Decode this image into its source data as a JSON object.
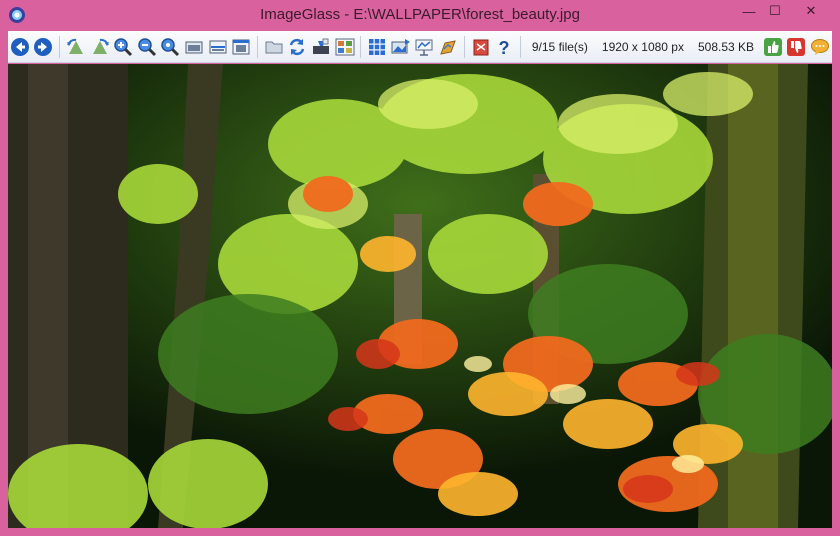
{
  "window": {
    "title": "ImageGlass - E:\\WALLPAPER\\forest_beauty.jpg"
  },
  "window_controls": {
    "minimize": "—",
    "maximize": "☐",
    "close": "✕"
  },
  "status": {
    "file_position": "9/15 file(s)",
    "dimensions": "1920 x 1080 px",
    "file_size": "508.53 KB"
  },
  "toolbar_icons": [
    "back-arrow-icon",
    "forward-arrow-icon",
    "rotate-left-icon",
    "rotate-right-icon",
    "zoom-in-icon",
    "zoom-out-icon",
    "actual-size-icon",
    "window-fit-icon",
    "fit-width-icon",
    "fit-height-icon",
    "open-folder-icon",
    "refresh-icon",
    "goto-image-icon",
    "thumbnail-icon",
    "grid-icon",
    "slideshow-icon",
    "fullscreen-icon",
    "set-wallpaper-icon",
    "settings-icon",
    "plugin-icon",
    "help-icon",
    "like-icon",
    "dislike-icon",
    "feedback-icon"
  ],
  "colors": {
    "frame": "#d9629e",
    "toolbar": "#eef2f8",
    "accent_blue": "#1f5fbf"
  },
  "image": {
    "alt": "forest_beauty.jpg"
  }
}
